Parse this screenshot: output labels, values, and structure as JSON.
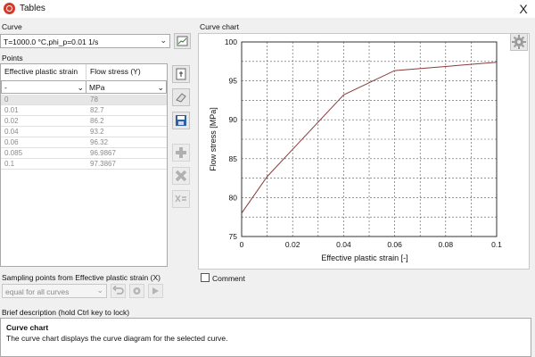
{
  "window": {
    "title": "Tables",
    "close_label": "X"
  },
  "curve": {
    "section_label": "Curve",
    "selected": "T=1000.0 °C,phi_p=0.01 1/s",
    "chart_section_label": "Curve chart"
  },
  "points": {
    "section_label": "Points",
    "columns": [
      "Effective plastic strain",
      "Flow stress (Y)"
    ],
    "units": [
      "-",
      "MPa"
    ],
    "rows": [
      [
        "0",
        "78"
      ],
      [
        "0.01",
        "82.7"
      ],
      [
        "0.02",
        "86.2"
      ],
      [
        "0.04",
        "93.2"
      ],
      [
        "0.06",
        "96.32"
      ],
      [
        "0.085",
        "96.9867"
      ],
      [
        "0.1",
        "97.3867"
      ]
    ]
  },
  "sampling": {
    "label": "Sampling points from Effective plastic strain (X)",
    "selected": "equal for all curves"
  },
  "comment": {
    "label": "Comment",
    "checked": false
  },
  "description": {
    "header": "Brief description (hold Ctrl key to lock)",
    "title": "Curve chart",
    "text": "The curve chart displays the curve diagram for the selected curve."
  },
  "icons": {
    "settings": "gear-icon",
    "curve_edit": "chart-edit-icon",
    "import": "import-icon",
    "clear": "eraser-icon",
    "save": "save-icon",
    "add": "plus-icon",
    "delete": "cross-icon",
    "formula": "formula-icon",
    "undo": "undo-icon",
    "sampling_settings": "gear-icon",
    "apply": "arrow-right-icon"
  },
  "colors": {
    "curve": "#8b3a3a",
    "grid": "#555555",
    "app_icon": "#d23a2a"
  },
  "chart_data": {
    "type": "line",
    "xlabel": "Effective plastic strain [-]",
    "ylabel": "Flow stress [MPa]",
    "xlim": [
      0,
      0.1
    ],
    "ylim": [
      75,
      100
    ],
    "xticks": [
      "0",
      "0.02",
      "0.04",
      "0.06",
      "0.08",
      "0.1"
    ],
    "yticks": [
      "75",
      "80",
      "85",
      "90",
      "95",
      "100"
    ],
    "grid": true,
    "series": [
      {
        "x": [
          0,
          0.01,
          0.02,
          0.04,
          0.06,
          0.085,
          0.1
        ],
        "y": [
          78,
          82.7,
          86.2,
          93.2,
          96.32,
          96.9867,
          97.3867
        ]
      }
    ]
  }
}
